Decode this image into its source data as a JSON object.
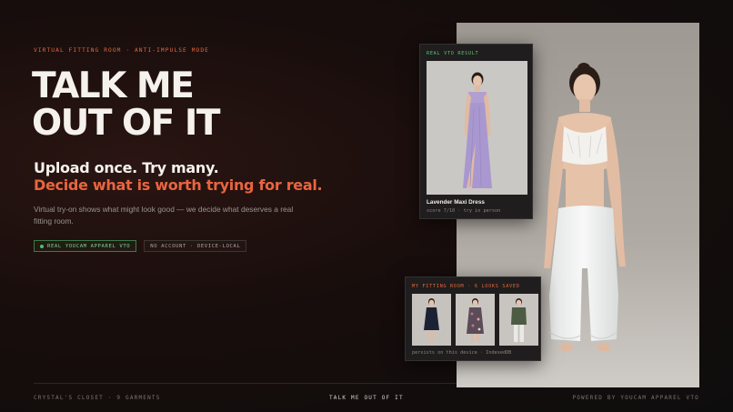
{
  "hero": {
    "eyebrow": "VIRTUAL FITTING ROOM · ANTI-IMPULSE MODE",
    "title_line1": "TALK ME",
    "title_line2": "OUT OF IT",
    "subtitle1": "Upload once. Try many.",
    "subtitle2": "Decide what is worth trying for real.",
    "description": "Virtual try-on shows what might look good — we decide what deserves a real fitting room."
  },
  "badges": [
    {
      "label": "REAL YOUCAM APPAREL VTO",
      "status_color": "#4cc06a"
    },
    {
      "label": "NO ACCOUNT · DEVICE-LOCAL"
    }
  ],
  "vto_result": {
    "label": "REAL VTO RESULT",
    "item_name": "Lavender Maxi Dress",
    "score_text": "score 7/10 · try in person"
  },
  "fitting_room": {
    "label": "MY FITTING ROOM · 6 LOOKS SAVED",
    "thumbnails": [
      {
        "icon": "navy-dress-look"
      },
      {
        "icon": "floral-dress-look"
      },
      {
        "icon": "green-jacket-look"
      }
    ],
    "note": "persists on this device · IndexedDB"
  },
  "footer": {
    "left": "CRYSTAL'S CLOSET · 9 GARMENTS",
    "center": "TALK ME OUT OF IT",
    "right": "POWERED BY YOUCAM APPAREL VTO"
  },
  "colors": {
    "accent": "#e8653f",
    "success": "#59c575",
    "background": "#170d0c"
  }
}
